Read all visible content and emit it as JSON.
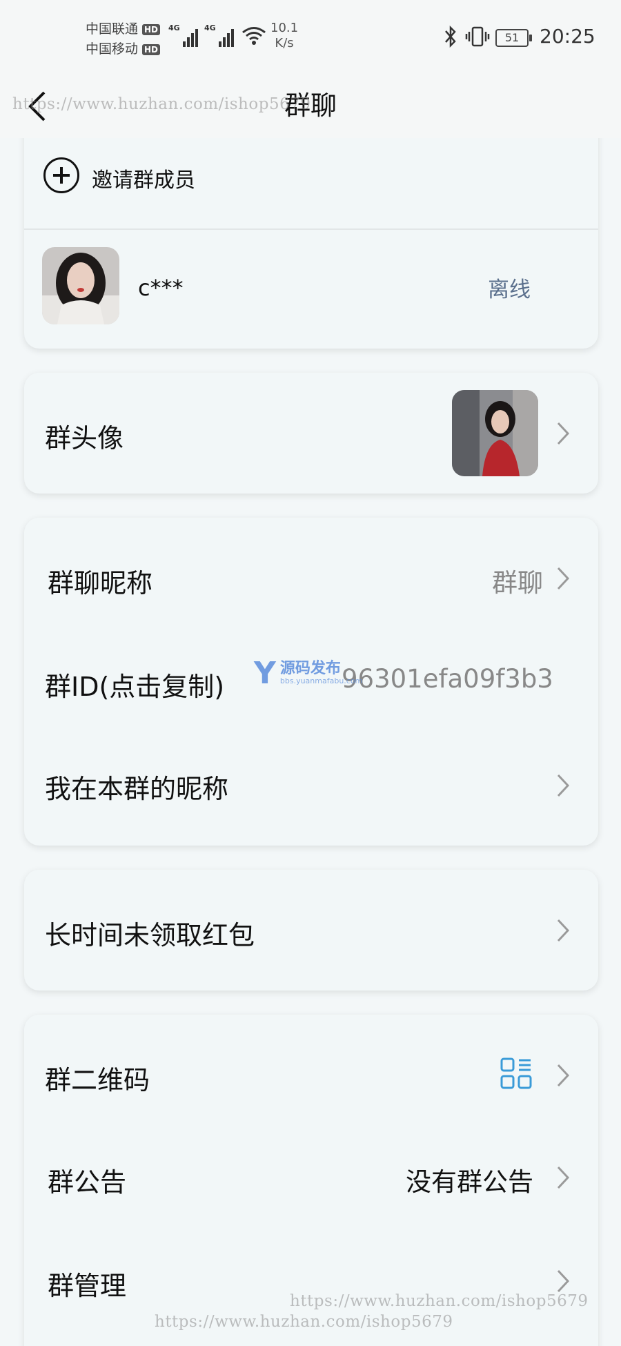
{
  "status_bar": {
    "carrier1": "中国联通",
    "carrier2": "中国移动",
    "hd_badge": "HD",
    "network1": "4G",
    "network2": "4G",
    "speed_value": "10.1",
    "speed_unit": "K/s",
    "battery": "51",
    "battery_level": 0.51,
    "time": "20:25"
  },
  "header": {
    "title": "群聊",
    "back_icon": "chevron-left-icon"
  },
  "members_card": {
    "invite_label": "邀请群成员",
    "invite_icon": "plus-circle-icon",
    "member": {
      "name": "c***",
      "status": "离线"
    }
  },
  "avatar_card": {
    "label": "群头像"
  },
  "info_card": {
    "nickname_label": "群聊昵称",
    "nickname_value": "群聊",
    "id_label": "群ID(点击复制)",
    "id_value": "96301efa09f3b3",
    "my_nickname_label": "我在本群的昵称"
  },
  "redpacket_card": {
    "label": "长时间未领取红包"
  },
  "settings_card": {
    "qr_label": "群二维码",
    "qr_icon": "qr-code-icon",
    "notice_label": "群公告",
    "notice_value": "没有群公告",
    "manage_label": "群管理"
  },
  "watermarks": {
    "url": "https://www.huzhan.com/ishop5679",
    "logo_main": "源码发布",
    "logo_sub": "bbs.yuanmafabu.com",
    "logo_letter": "Y"
  },
  "colors": {
    "background": "#f3f7f8",
    "card": "#f2f7f8",
    "status_offline": "#5a6f8c",
    "secondary_text": "#888888",
    "qr_accent": "#3a9bd8"
  }
}
